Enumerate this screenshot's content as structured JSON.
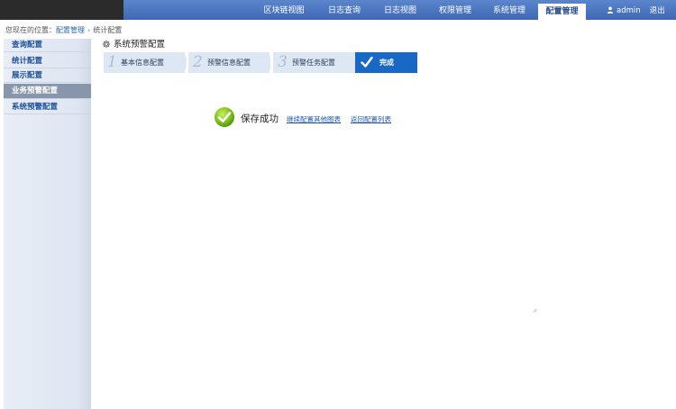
{
  "nav": {
    "items": [
      {
        "label": "区块链视图"
      },
      {
        "label": "日志查询"
      },
      {
        "label": "日志视图"
      },
      {
        "label": "权限管理"
      },
      {
        "label": "系统管理"
      },
      {
        "label": "配置管理",
        "active": true
      }
    ],
    "user": "admin",
    "logout": "退出"
  },
  "breadcrumb": {
    "prefix": "您现在的位置：",
    "parent": "配置管理",
    "separator": "›",
    "current": "统计配置"
  },
  "sidebar": {
    "items": [
      {
        "label": "查询配置"
      },
      {
        "label": "统计配置"
      },
      {
        "label": "展示配置"
      },
      {
        "label": "业务预警配置",
        "active": true
      },
      {
        "label": "系统预警配置"
      }
    ]
  },
  "page": {
    "title": "系统预警配置"
  },
  "steps": [
    {
      "number": "1",
      "label": "基本信息配置"
    },
    {
      "number": "2",
      "label": "预警信息配置"
    },
    {
      "number": "3",
      "label": "预警任务配置"
    },
    {
      "number": "",
      "label": "完成",
      "done": true
    }
  ],
  "result": {
    "message": "保存成功",
    "link_continue": "继续配置其他图表",
    "link_back": "返回配置列表"
  },
  "colors": {
    "nav_bar": "#4a75bf",
    "step_done": "#1769c5",
    "sidebar_active": "#8796ab",
    "link": "#1c56b0"
  }
}
